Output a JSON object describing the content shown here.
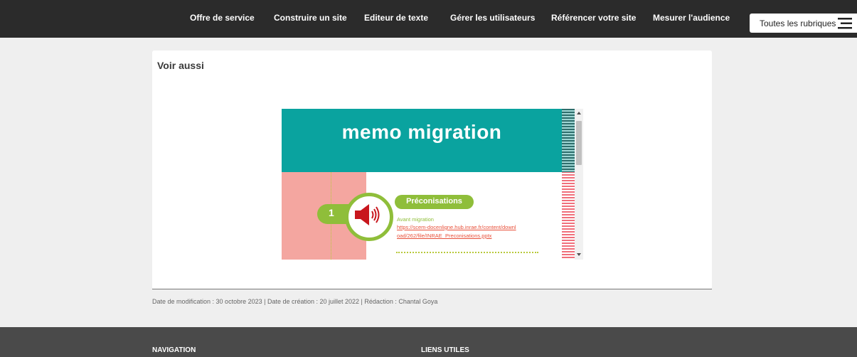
{
  "nav": {
    "items": [
      {
        "label": "Offre de service"
      },
      {
        "label": "Construire un site"
      },
      {
        "label": "Editeur de texte"
      },
      {
        "label": "Gérer les utilisateurs"
      },
      {
        "label": "Référencer votre site"
      },
      {
        "label": "Mesurer l'audience"
      }
    ],
    "rubriques_label": "Toutes les rubriques",
    "menu_icon": "hamburger-menu-icon"
  },
  "card": {
    "title": "Voir aussi"
  },
  "slide": {
    "title": "memo migration",
    "number": "1",
    "pill_label": "Préconisations",
    "subtitle": "Avant migration",
    "link": "https://scem-docenligne.hub.inrae.fr/content/download/262/file/INRAE_Preconisations.pptx",
    "icon": "speaker-icon",
    "colors": {
      "banner": "#0aa39f",
      "pink": "#f4a6a0",
      "green": "#8fbe3a",
      "link": "#e8503a",
      "speaker": "#c8161d"
    }
  },
  "meta": {
    "text": "Date de modification : 30 octobre 2023 | Date de création : 20 juillet 2022 | Rédaction : Chantal Goya"
  },
  "footer": {
    "navigation_heading": "NAVIGATION",
    "links_heading": "LIENS UTILES"
  }
}
